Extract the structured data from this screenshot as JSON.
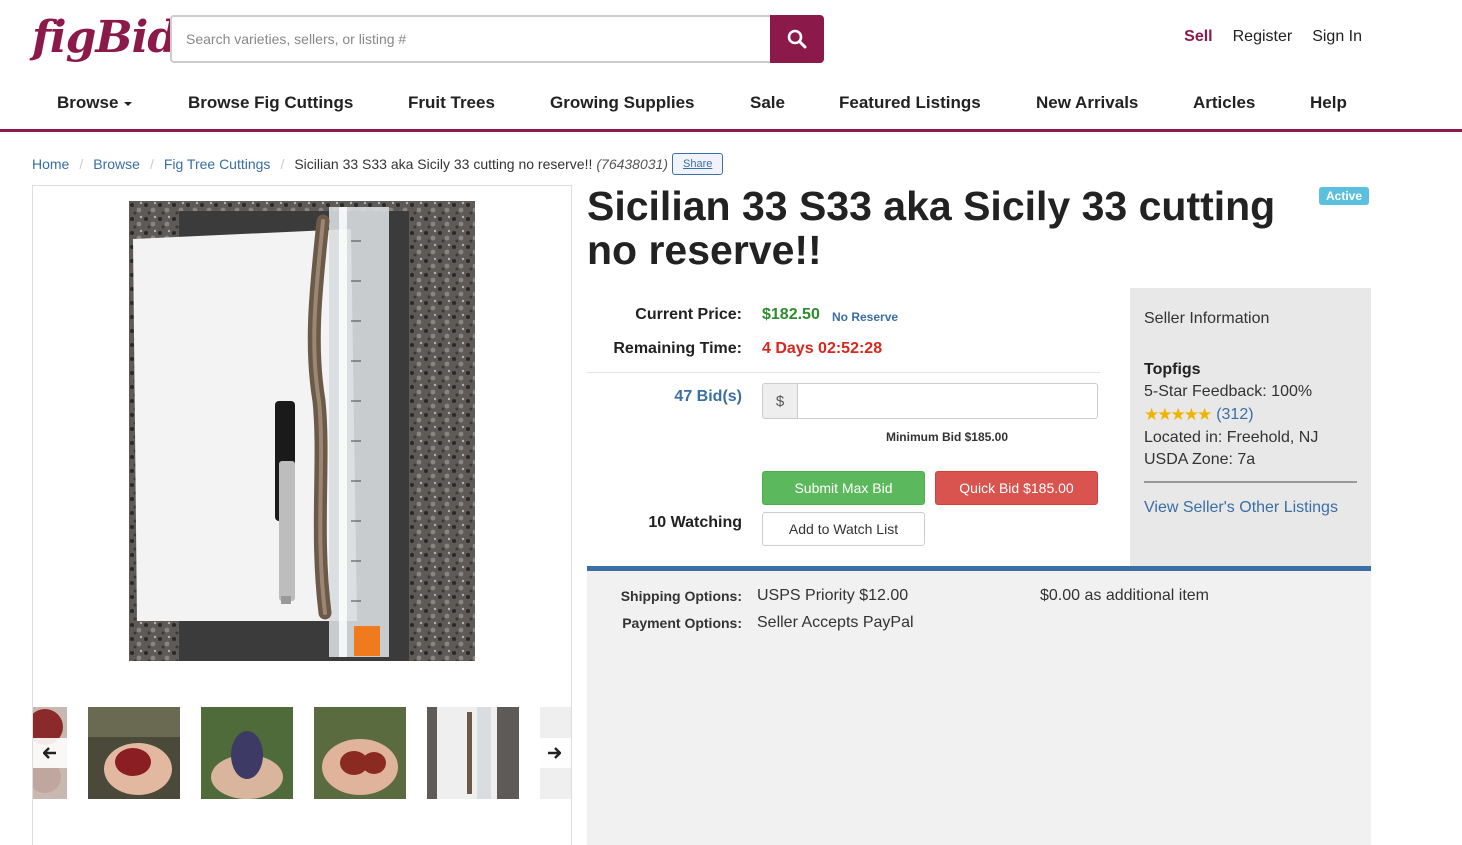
{
  "header": {
    "logo": "figBid",
    "search_placeholder": "Search varieties, sellers, or listing #",
    "sell": "Sell",
    "register": "Register",
    "sign_in": "Sign In"
  },
  "nav": [
    "Browse",
    "Browse Fig Cuttings",
    "Fruit Trees",
    "Growing Supplies",
    "Sale",
    "Featured Listings",
    "New Arrivals",
    "Articles",
    "Help"
  ],
  "breadcrumb": {
    "home": "Home",
    "browse": "Browse",
    "category": "Fig Tree Cuttings",
    "current": "Sicilian 33 S33 aka Sicily 33 cutting no reserve!!",
    "listing_num": "(76438031)",
    "share": "Share"
  },
  "listing": {
    "title": "Sicilian 33 S33 aka Sicily 33 cutting no reserve!!",
    "status": "Active",
    "current_price_label": "Current Price:",
    "current_price": "$182.50",
    "no_reserve": "No Reserve",
    "remaining_label": "Remaining Time:",
    "remaining": "4 Days 02:52:28",
    "bids": "47 Bid(s)",
    "currency": "$",
    "min_bid": "Minimum Bid $185.00",
    "submit_max": "Submit Max Bid",
    "quick_bid": "Quick Bid $185.00",
    "watching": "10 Watching",
    "add_watch": "Add to Watch List"
  },
  "seller": {
    "heading": "Seller Information",
    "name": "Topfigs",
    "feedback": "5-Star Feedback: 100%",
    "feedback_count": "(312)",
    "location": "Located in: Freehold, NJ",
    "zone": "USDA Zone: 7a",
    "other_listings": "View Seller's Other Listings"
  },
  "shipping": {
    "shipping_label": "Shipping Options:",
    "shipping_value": "USPS Priority $12.00",
    "additional": "$0.00 as additional item",
    "payment_label": "Payment Options:",
    "payment_value": "Seller Accepts PayPal"
  },
  "colors": {
    "brand": "#8b1a4a",
    "link": "#3a6ea5",
    "price": "#2e8b2e",
    "remaining": "#d9261c"
  }
}
